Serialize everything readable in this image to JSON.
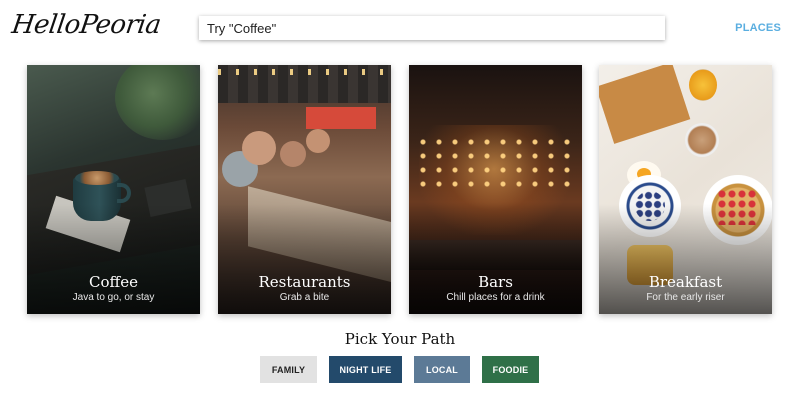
{
  "header": {
    "logo_text": "HelloPeoria",
    "search_placeholder": "Try \"Coffee\"",
    "nav_places": "PLACES",
    "nav_color": "#5aaee0"
  },
  "cards": [
    {
      "title": "Coffee",
      "subtitle": "Java to go, or stay"
    },
    {
      "title": "Restaurants",
      "subtitle": "Grab a bite"
    },
    {
      "title": "Bars",
      "subtitle": "Chill places for a drink"
    },
    {
      "title": "Breakfast",
      "subtitle": "For the early riser"
    }
  ],
  "paths": {
    "heading": "Pick Your Path",
    "buttons": [
      {
        "label": "FAMILY",
        "color": "#e2e2e2"
      },
      {
        "label": "NIGHT LIFE",
        "color": "#234a6b"
      },
      {
        "label": "LOCAL",
        "color": "#5c7a96"
      },
      {
        "label": "FOODIE",
        "color": "#2f7048"
      }
    ]
  }
}
